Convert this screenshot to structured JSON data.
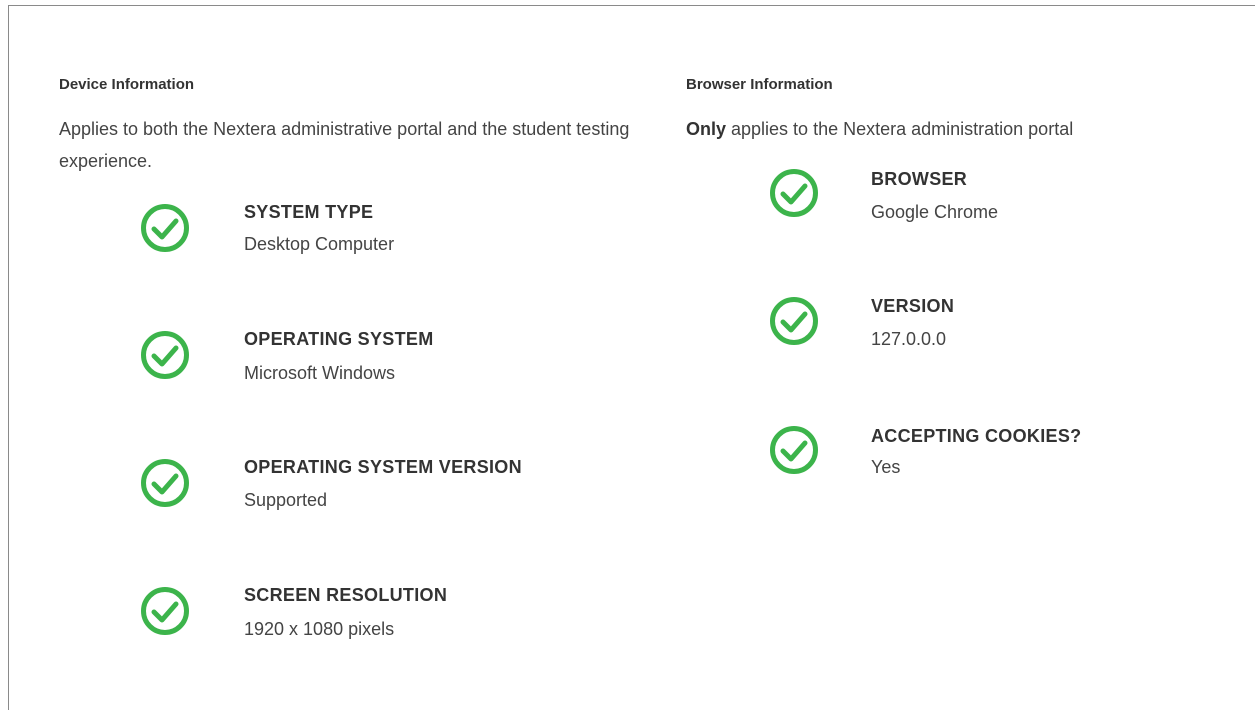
{
  "colors": {
    "check_green": "#3cb44b",
    "text": "#333333",
    "frame": "#8a8a8a"
  },
  "device": {
    "heading": "Device Information",
    "description": "Applies to both the Nextera administrative portal and the student testing experience.",
    "items": [
      {
        "icon": "check-circle-icon",
        "label": "SYSTEM TYPE",
        "value": "Desktop Computer"
      },
      {
        "icon": "check-circle-icon",
        "label": "OPERATING SYSTEM",
        "value": "Microsoft Windows"
      },
      {
        "icon": "check-circle-icon",
        "label": "OPERATING SYSTEM VERSION",
        "value": "Supported"
      },
      {
        "icon": "check-circle-icon",
        "label": "SCREEN RESOLUTION",
        "value": "1920 x 1080 pixels"
      }
    ]
  },
  "browser": {
    "heading": "Browser Information",
    "description_bold": "Only",
    "description_rest": " applies to the Nextera administration portal",
    "items": [
      {
        "icon": "check-circle-icon",
        "label": "BROWSER",
        "value": "Google Chrome"
      },
      {
        "icon": "check-circle-icon",
        "label": "VERSION",
        "value": "127.0.0.0"
      },
      {
        "icon": "check-circle-icon",
        "label": "ACCEPTING COOKIES?",
        "value": "Yes"
      }
    ]
  }
}
